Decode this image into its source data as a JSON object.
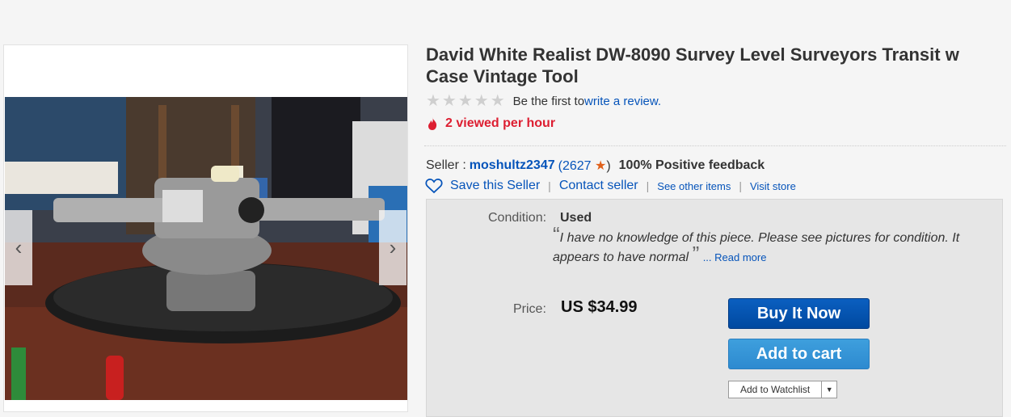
{
  "listing": {
    "title": "David White Realist DW-8090 Survey Level Surveyors Transit w Case Vintage Tool",
    "rating_prefix": "Be the first to ",
    "rating_link": "write a review.",
    "rating_stars": 0,
    "viewed": "2 viewed per hour"
  },
  "gallery": {
    "prev_label": "‹",
    "next_label": "›"
  },
  "seller": {
    "label": "Seller :",
    "name": "moshultz2347",
    "score_open": "(",
    "score": "2627",
    "score_close": ")",
    "feedback": "100% Positive feedback",
    "save": "Save this Seller",
    "contact": "Contact seller",
    "other_items": "See other items",
    "visit_store": "Visit store"
  },
  "item": {
    "condition_label": "Condition:",
    "condition_value": "Used",
    "condition_note": "I have no knowledge of this piece. Please see pictures for condition. It appears to have normal",
    "read_more": "... Read more",
    "price_label": "Price:",
    "price": "US $34.99"
  },
  "buttons": {
    "buy_now": "Buy It Now",
    "add_to_cart": "Add to cart",
    "watchlist": "Add to Watchlist"
  },
  "colors": {
    "link": "#0654ba",
    "viewed": "#dd1e31",
    "buy_button": "#0654ba",
    "cart_button": "#3498db",
    "score_star": "#e0601a"
  }
}
